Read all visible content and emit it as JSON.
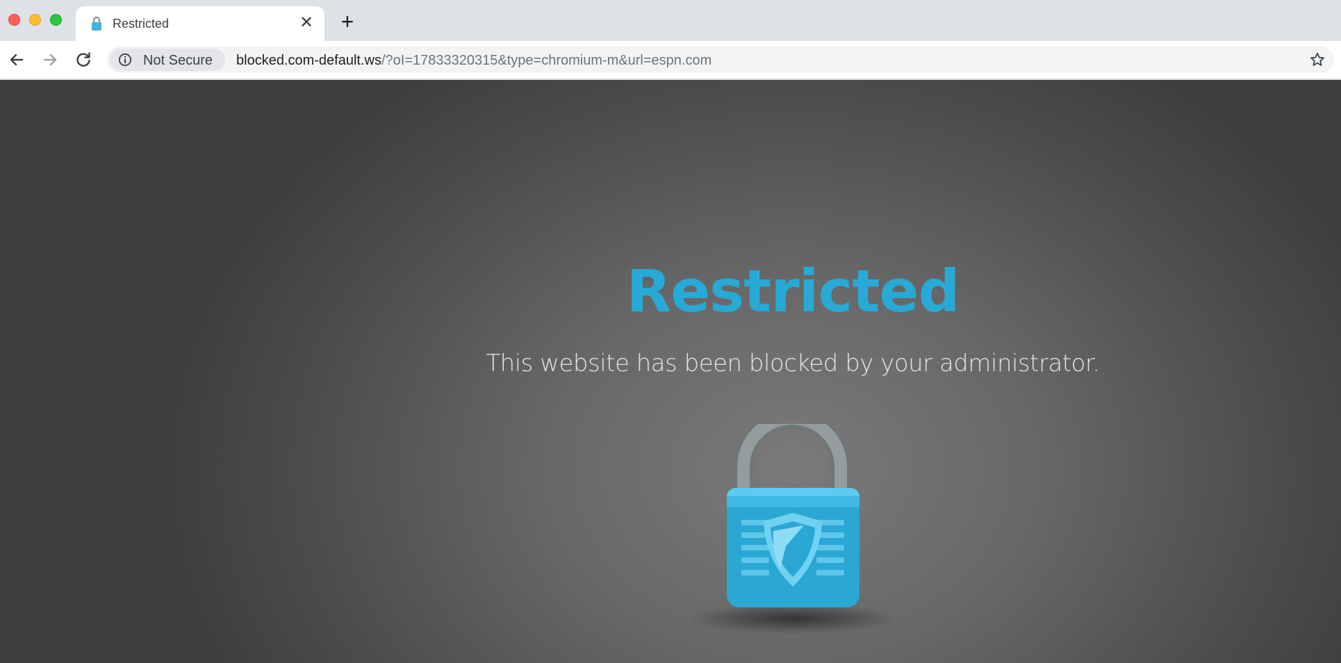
{
  "window": {
    "controls": [
      "close",
      "minimize",
      "maximize"
    ]
  },
  "tab": {
    "title": "Restricted",
    "favicon": "lock-icon",
    "close_glyph": "✕"
  },
  "new_tab_glyph": "+",
  "toolbar": {
    "back_icon": "back-arrow-icon",
    "forward_icon": "forward-arrow-icon",
    "reload_icon": "reload-icon",
    "security_label": "Not Secure",
    "url_host": "blocked.com-default.ws",
    "url_rest": "/?oI=17833320315&type=chromium-m&url=espn.com",
    "bookmark_icon": "star-icon"
  },
  "page": {
    "title": "Restricted",
    "message": "This website has been blocked by your administrator.",
    "illustration": "padlock-shield-icon"
  },
  "colors": {
    "accent": "#28a9d6",
    "lock_body": "#2eaed8",
    "lock_shackle": "#8e9597"
  }
}
